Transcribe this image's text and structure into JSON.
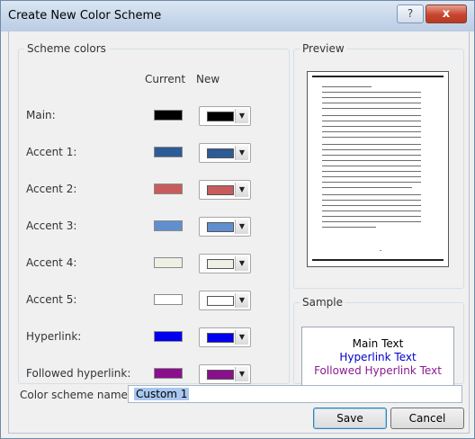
{
  "window": {
    "title": "Create New Color Scheme",
    "help_label": "?",
    "close_label": "x"
  },
  "scheme_colors": {
    "group_label": "Scheme colors",
    "current_header": "Current",
    "new_header": "New",
    "rows": [
      {
        "label": "Main:",
        "current": "#000000",
        "new": "#000000"
      },
      {
        "label": "Accent 1:",
        "current": "#2c5b96",
        "new": "#2c5b96"
      },
      {
        "label": "Accent 2:",
        "current": "#c85c5c",
        "new": "#c85c5c"
      },
      {
        "label": "Accent 3:",
        "current": "#5f8fcf",
        "new": "#5f8fcf"
      },
      {
        "label": "Accent 4:",
        "current": "#eef0e4",
        "new": "#eef0e4"
      },
      {
        "label": "Accent 5:",
        "current": "#ffffff",
        "new": "#ffffff"
      },
      {
        "label": "Hyperlink:",
        "current": "#0000ee",
        "new": "#0000ee"
      },
      {
        "label": "Followed hyperlink:",
        "current": "#8a0f8c",
        "new": "#8a0f8c"
      }
    ],
    "dropdown_arrow": "▼"
  },
  "preview": {
    "group_label": "Preview",
    "footer_mark": "-"
  },
  "sample": {
    "group_label": "Sample",
    "main_text": "Main Text",
    "hyperlink_text": "Hyperlink Text",
    "followed_text": "Followed Hyperlink Text"
  },
  "scheme_name": {
    "label": "Color scheme name:",
    "value": "Custom 1"
  },
  "buttons": {
    "save": "Save",
    "cancel": "Cancel"
  }
}
